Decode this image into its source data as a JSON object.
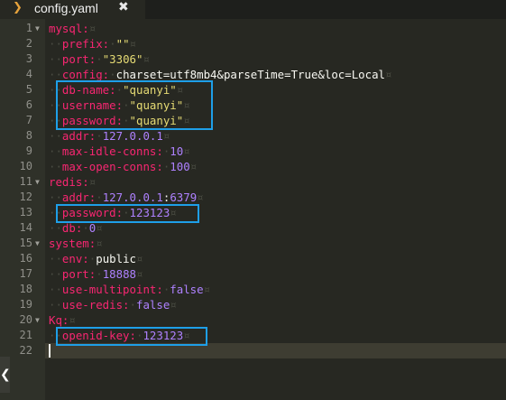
{
  "tab": {
    "icon": "yaml-file-icon",
    "title": "config.yaml",
    "close_glyph": "✖"
  },
  "back_button": {
    "glyph": "❮",
    "icon": "chevron-left-icon"
  },
  "lines": [
    {
      "n": "1",
      "fold": true,
      "indent": 0,
      "tokens": [
        [
          "k",
          "mysql:"
        ]
      ]
    },
    {
      "n": "2",
      "fold": false,
      "indent": 1,
      "tokens": [
        [
          "k",
          "prefix:"
        ],
        [
          "ws",
          "·"
        ],
        [
          "s",
          "\"\""
        ]
      ]
    },
    {
      "n": "3",
      "fold": false,
      "indent": 1,
      "tokens": [
        [
          "k",
          "port:"
        ],
        [
          "ws",
          "·"
        ],
        [
          "s",
          "\"3306\""
        ]
      ]
    },
    {
      "n": "4",
      "fold": false,
      "indent": 1,
      "tokens": [
        [
          "k",
          "config:"
        ],
        [
          "ws",
          "·"
        ],
        [
          "v",
          "charset=utf8mb4&parseTime=True&loc=Local"
        ]
      ]
    },
    {
      "n": "5",
      "fold": false,
      "indent": 1,
      "tokens": [
        [
          "k",
          "db-name:"
        ],
        [
          "ws",
          "·"
        ],
        [
          "s",
          "\"quanyi\""
        ]
      ]
    },
    {
      "n": "6",
      "fold": false,
      "indent": 1,
      "tokens": [
        [
          "k",
          "username:"
        ],
        [
          "ws",
          "·"
        ],
        [
          "s",
          "\"quanyi\""
        ]
      ]
    },
    {
      "n": "7",
      "fold": false,
      "indent": 1,
      "tokens": [
        [
          "k",
          "password:"
        ],
        [
          "ws",
          "·"
        ],
        [
          "s",
          "\"quanyi\""
        ]
      ]
    },
    {
      "n": "8",
      "fold": false,
      "indent": 1,
      "tokens": [
        [
          "k",
          "addr:"
        ],
        [
          "ws",
          "·"
        ],
        [
          "n",
          "127.0.0.1"
        ]
      ]
    },
    {
      "n": "9",
      "fold": false,
      "indent": 1,
      "tokens": [
        [
          "k",
          "max-idle-conns:"
        ],
        [
          "ws",
          "·"
        ],
        [
          "n",
          "10"
        ]
      ]
    },
    {
      "n": "10",
      "fold": false,
      "indent": 1,
      "tokens": [
        [
          "k",
          "max-open-conns:"
        ],
        [
          "ws",
          "·"
        ],
        [
          "n",
          "100"
        ]
      ]
    },
    {
      "n": "11",
      "fold": true,
      "indent": 0,
      "tokens": [
        [
          "k",
          "redis:"
        ]
      ]
    },
    {
      "n": "12",
      "fold": false,
      "indent": 1,
      "tokens": [
        [
          "k",
          "addr:"
        ],
        [
          "ws",
          "·"
        ],
        [
          "n",
          "127.0.0.1"
        ],
        [
          "v",
          ":"
        ],
        [
          "n",
          "6379"
        ]
      ]
    },
    {
      "n": "13",
      "fold": false,
      "indent": 1,
      "tokens": [
        [
          "k",
          "password:"
        ],
        [
          "ws",
          "·"
        ],
        [
          "n",
          "123123"
        ]
      ]
    },
    {
      "n": "14",
      "fold": false,
      "indent": 1,
      "tokens": [
        [
          "k",
          "db:"
        ],
        [
          "ws",
          "·"
        ],
        [
          "n",
          "0"
        ]
      ]
    },
    {
      "n": "15",
      "fold": true,
      "indent": 0,
      "tokens": [
        [
          "k",
          "system:"
        ]
      ]
    },
    {
      "n": "16",
      "fold": false,
      "indent": 1,
      "tokens": [
        [
          "k",
          "env:"
        ],
        [
          "ws",
          "·"
        ],
        [
          "v",
          "public"
        ]
      ]
    },
    {
      "n": "17",
      "fold": false,
      "indent": 1,
      "tokens": [
        [
          "k",
          "port:"
        ],
        [
          "ws",
          "·"
        ],
        [
          "n",
          "18888"
        ]
      ]
    },
    {
      "n": "18",
      "fold": false,
      "indent": 1,
      "tokens": [
        [
          "k",
          "use-multipoint:"
        ],
        [
          "ws",
          "·"
        ],
        [
          "n",
          "false"
        ]
      ]
    },
    {
      "n": "19",
      "fold": false,
      "indent": 1,
      "tokens": [
        [
          "k",
          "use-redis:"
        ],
        [
          "ws",
          "·"
        ],
        [
          "n",
          "false"
        ]
      ]
    },
    {
      "n": "20",
      "fold": true,
      "indent": 0,
      "tokens": [
        [
          "k",
          "Kq:"
        ]
      ]
    },
    {
      "n": "21",
      "fold": false,
      "indent": 1,
      "tokens": [
        [
          "k",
          "openid-key:"
        ],
        [
          "ws",
          "·"
        ],
        [
          "n",
          "123123"
        ]
      ]
    },
    {
      "n": "22",
      "fold": false,
      "indent": 0,
      "tokens": []
    }
  ],
  "colors": {
    "key": "#f92672",
    "string": "#e6db74",
    "number": "#ae81ff",
    "highlight_box": "#1e9fe8"
  }
}
